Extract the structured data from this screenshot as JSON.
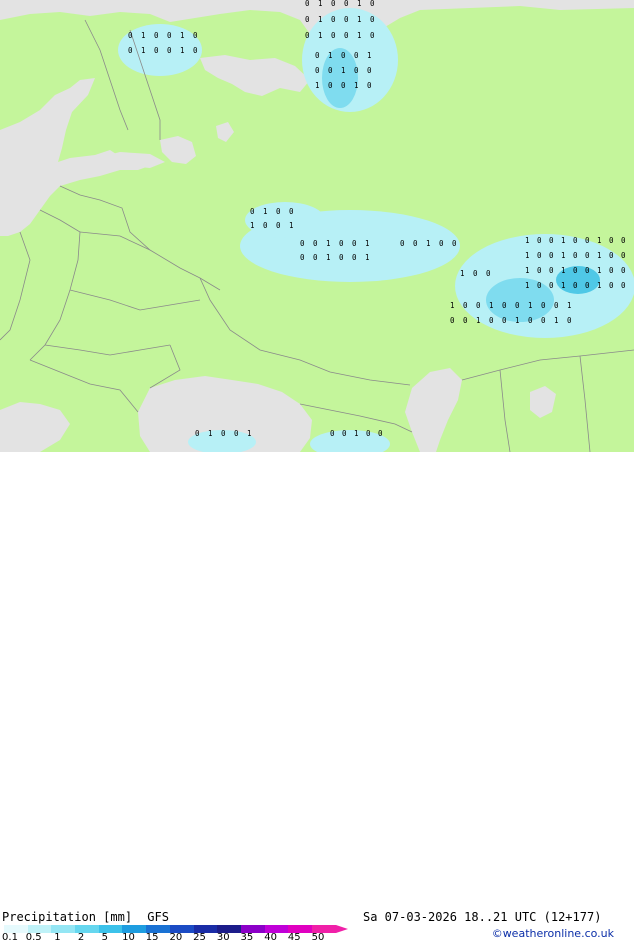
{
  "map": {
    "colors": {
      "land": "#c4f59b",
      "water": "#e3e3e3",
      "border": "#8a8a8a",
      "precip_light": "#b7f0f6",
      "precip_mid": "#7fdcef",
      "precip_strong": "#4fc8e6",
      "marker": "#000000"
    },
    "markers": [
      "0",
      "1"
    ]
  },
  "footer": {
    "title": "Precipitation [mm]",
    "model": "GFS",
    "valid_time": "Sa 07-03-2026 18..21 UTC (12+177)",
    "credit": "©weatheronline.co.uk",
    "scale_labels": [
      "0.1",
      "0.5",
      "1",
      "2",
      "5",
      "10",
      "15",
      "20",
      "25",
      "30",
      "35",
      "40",
      "45",
      "50"
    ],
    "scale_colors": [
      "#e6fafd",
      "#bff2f8",
      "#94e6f4",
      "#66d7ef",
      "#3cc2ea",
      "#1e9de0",
      "#1a72d4",
      "#1b4bc4",
      "#1a2ca6",
      "#1c1c8a",
      "#8c00c8",
      "#c000d8",
      "#e000c0",
      "#f020a8"
    ]
  }
}
